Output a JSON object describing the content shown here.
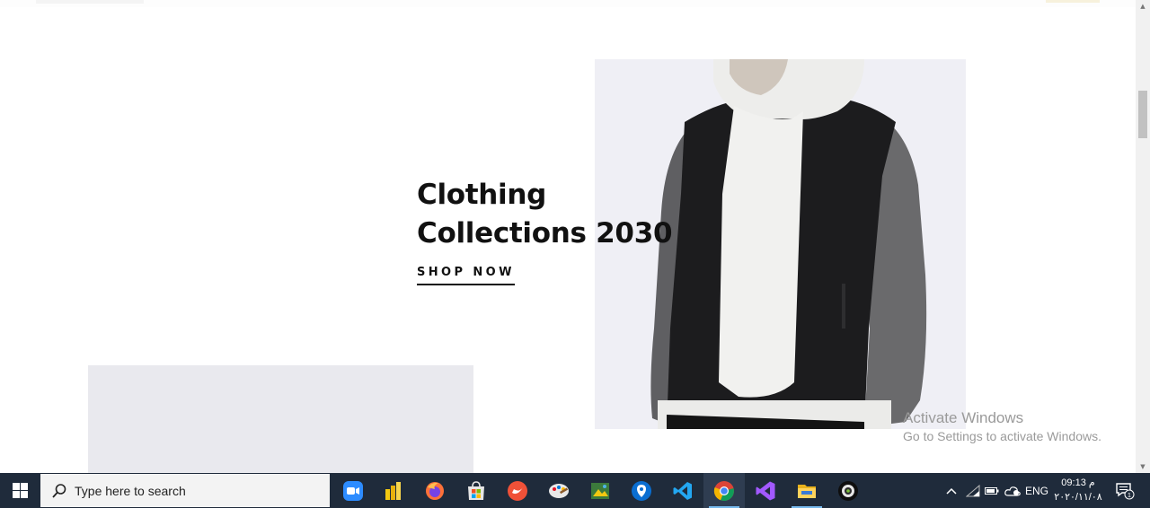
{
  "hero": {
    "title_line1": "Clothing",
    "title_line2": "Collections 2030",
    "cta": "SHOP NOW"
  },
  "watermark": {
    "title": "Activate Windows",
    "subtitle": "Go to Settings to activate Windows."
  },
  "taskbar": {
    "search_placeholder": "Type here to search",
    "apps": [
      "zoom-icon",
      "power-bi-icon",
      "firefox-icon",
      "store-icon",
      "swift-playgrounds-icon",
      "paint-icon",
      "photos-icon",
      "maps-icon",
      "vscode-icon",
      "chrome-icon",
      "visual-studio-icon",
      "file-explorer-icon",
      "camera-app-icon"
    ],
    "language": "ENG",
    "time": "09:13 م",
    "date": "٢٠٢٠/١١/٠٨"
  },
  "colors": {
    "taskbar": "#1f2b3b",
    "hero_bg": "#efeff5",
    "text": "#111111"
  }
}
